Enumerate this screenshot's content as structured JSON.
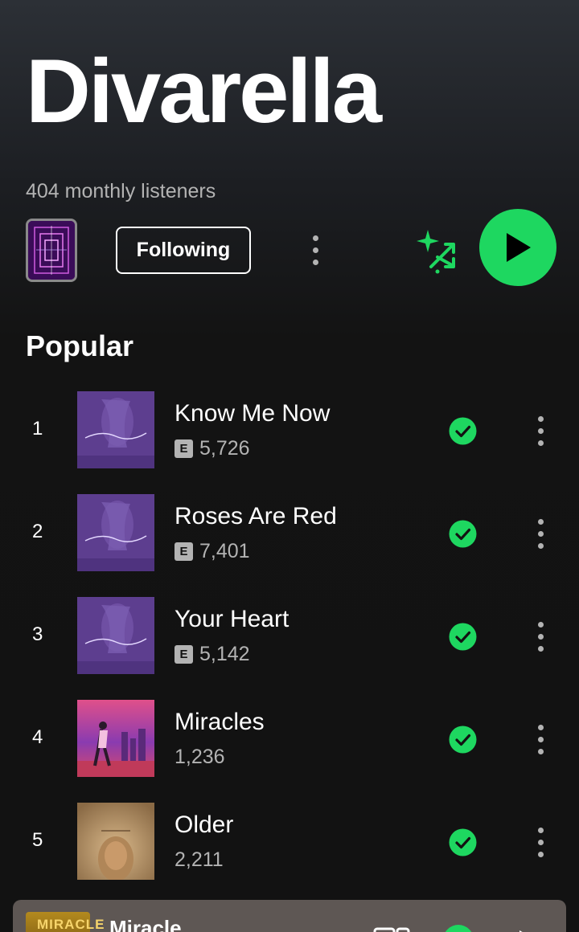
{
  "artist": {
    "name": "Divarella",
    "monthly_listeners": "404 monthly listeners",
    "following_label": "Following"
  },
  "popular": {
    "title": "Popular",
    "tracks": [
      {
        "rank": "1",
        "title": "Know Me Now",
        "plays": "5,726",
        "explicit": true
      },
      {
        "rank": "2",
        "title": "Roses Are Red",
        "plays": "7,401",
        "explicit": true
      },
      {
        "rank": "3",
        "title": "Your Heart",
        "plays": "5,142",
        "explicit": true
      },
      {
        "rank": "4",
        "title": "Miracles",
        "plays": "1,236",
        "explicit": false
      },
      {
        "rank": "5",
        "title": "Older",
        "plays": "2,211",
        "explicit": false
      }
    ],
    "explicit_badge": "E"
  },
  "now_playing": {
    "title": "Miracle",
    "cover_text": "MIRACLE"
  },
  "icons": {
    "more": "more-vert-icon",
    "smart_shuffle": "smart-shuffle-icon",
    "play": "play-icon",
    "saved": "check-circle-icon",
    "devices": "devices-icon"
  },
  "colors": {
    "accent": "#1ed760",
    "background": "#121212",
    "secondary_text": "#b3b3b3",
    "mini_player": "#5e5754"
  }
}
